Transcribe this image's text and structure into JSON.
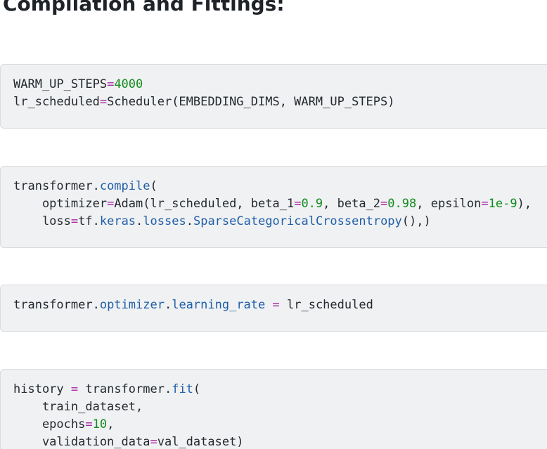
{
  "heading": "Compilation and Fittings:",
  "cells": [
    {
      "lines": [
        [
          {
            "t": "WARM_UP_STEPS",
            "k": "plain"
          },
          {
            "t": "=",
            "k": "op"
          },
          {
            "t": "4000",
            "k": "num"
          }
        ],
        [
          {
            "t": "lr_scheduled",
            "k": "plain"
          },
          {
            "t": "=",
            "k": "op"
          },
          {
            "t": "Scheduler(EMBEDDING_DIMS, WARM_UP_STEPS)",
            "k": "plain"
          }
        ]
      ]
    },
    {
      "lines": [
        [
          {
            "t": "transformer.",
            "k": "plain"
          },
          {
            "t": "compile",
            "k": "attr"
          },
          {
            "t": "(",
            "k": "plain"
          }
        ],
        [
          {
            "t": "    optimizer",
            "k": "plain"
          },
          {
            "t": "=",
            "k": "op"
          },
          {
            "t": "Adam(lr_scheduled, beta_1",
            "k": "plain"
          },
          {
            "t": "=",
            "k": "op"
          },
          {
            "t": "0.9",
            "k": "num"
          },
          {
            "t": ", beta_2",
            "k": "plain"
          },
          {
            "t": "=",
            "k": "op"
          },
          {
            "t": "0.98",
            "k": "num"
          },
          {
            "t": ", epsilon",
            "k": "plain"
          },
          {
            "t": "=",
            "k": "op"
          },
          {
            "t": "1e-9",
            "k": "num"
          },
          {
            "t": "),",
            "k": "plain"
          }
        ],
        [
          {
            "t": "    loss",
            "k": "plain"
          },
          {
            "t": "=",
            "k": "op"
          },
          {
            "t": "tf.",
            "k": "plain"
          },
          {
            "t": "keras",
            "k": "attr"
          },
          {
            "t": ".",
            "k": "plain"
          },
          {
            "t": "losses",
            "k": "attr"
          },
          {
            "t": ".",
            "k": "plain"
          },
          {
            "t": "SparseCategoricalCrossentropy",
            "k": "attr"
          },
          {
            "t": "(),)",
            "k": "plain"
          }
        ]
      ]
    },
    {
      "lines": [
        [
          {
            "t": "transformer.",
            "k": "plain"
          },
          {
            "t": "optimizer",
            "k": "attr"
          },
          {
            "t": ".",
            "k": "plain"
          },
          {
            "t": "learning_rate",
            "k": "attr"
          },
          {
            "t": " ",
            "k": "plain"
          },
          {
            "t": "=",
            "k": "op"
          },
          {
            "t": " lr_scheduled",
            "k": "plain"
          }
        ]
      ]
    },
    {
      "lines": [
        [
          {
            "t": "history ",
            "k": "plain"
          },
          {
            "t": "=",
            "k": "op"
          },
          {
            "t": " transformer.",
            "k": "plain"
          },
          {
            "t": "fit",
            "k": "attr"
          },
          {
            "t": "(",
            "k": "plain"
          }
        ],
        [
          {
            "t": "    train_dataset,",
            "k": "plain"
          }
        ],
        [
          {
            "t": "    epochs",
            "k": "plain"
          },
          {
            "t": "=",
            "k": "op"
          },
          {
            "t": "10",
            "k": "num"
          },
          {
            "t": ",",
            "k": "plain"
          }
        ],
        [
          {
            "t": "    validation_data",
            "k": "plain"
          },
          {
            "t": "=",
            "k": "op"
          },
          {
            "t": "val_dataset)",
            "k": "plain"
          }
        ]
      ]
    }
  ]
}
